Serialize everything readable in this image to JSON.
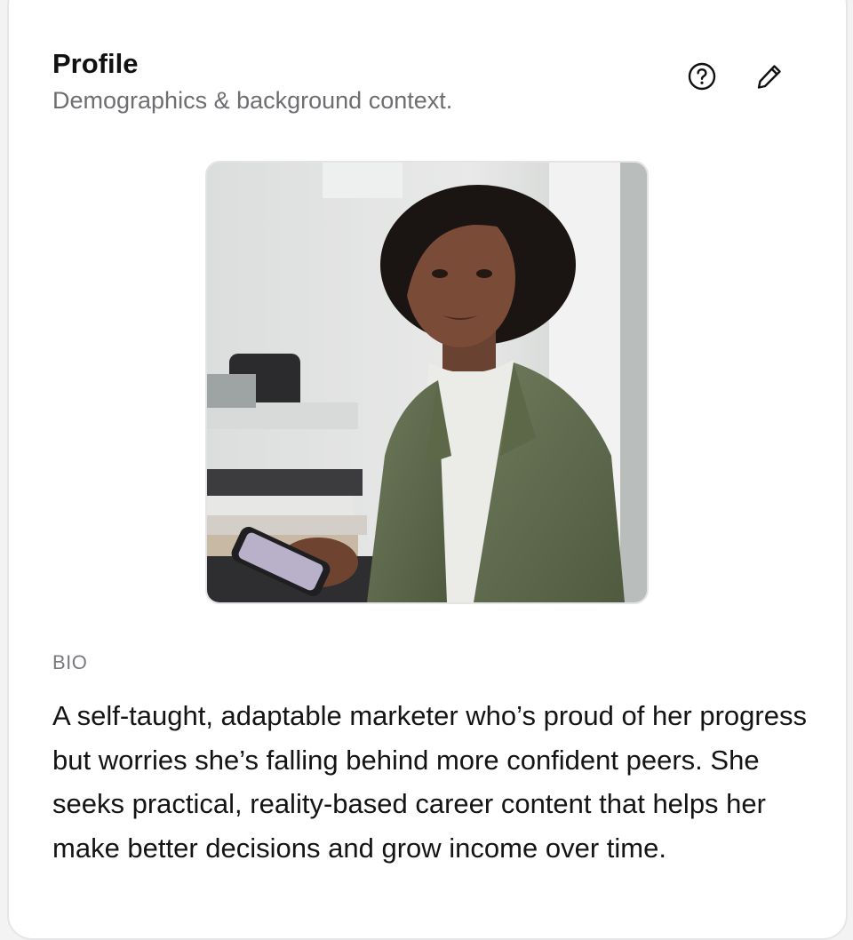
{
  "profile": {
    "title": "Profile",
    "subtitle": "Demographics & background context.",
    "actions": {
      "help_icon": "question-circle-icon",
      "edit_icon": "pencil-icon"
    },
    "photo_alt": "Portrait of a woman in a green blazer holding a phone"
  },
  "bio": {
    "label": "BIO",
    "text": "A self-taught, adaptable marketer who’s proud of her progress but worries she’s falling behind more confident peers. She seeks practical, reality-based career content that helps her make better decisions and grow income over time."
  }
}
